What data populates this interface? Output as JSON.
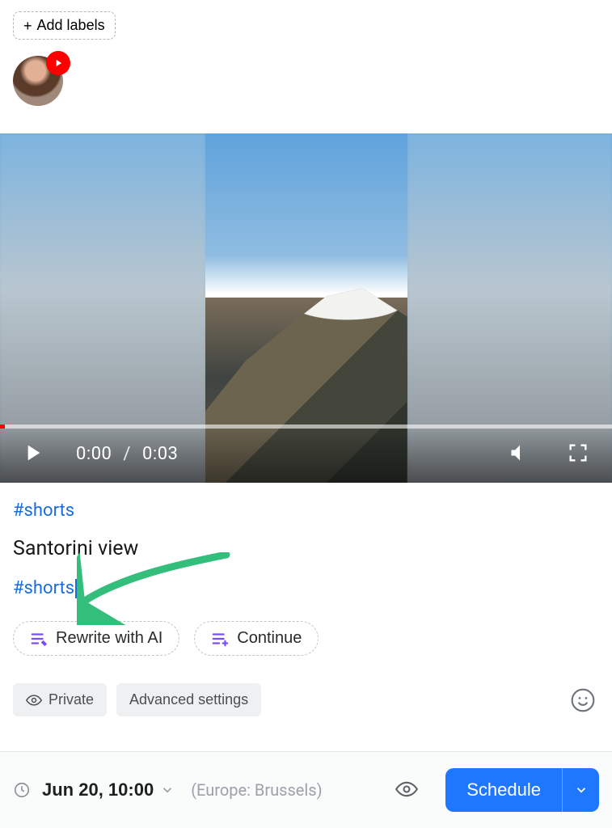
{
  "header": {
    "add_labels": "Add labels"
  },
  "account": {
    "platform_icon": "youtube"
  },
  "video": {
    "current_time": "0:00",
    "separator": "/",
    "duration": "0:03"
  },
  "caption": {
    "hashtag_top": "#shorts",
    "title": "Santorini view",
    "hashtag_bottom": "#shorts"
  },
  "ai": {
    "rewrite": "Rewrite with AI",
    "continue": "Continue"
  },
  "settings": {
    "private": "Private",
    "advanced": "Advanced settings"
  },
  "footer": {
    "datetime": "Jun 20, 10:00",
    "timezone": "(Europe: Brussels)",
    "schedule": "Schedule"
  },
  "colors": {
    "accent": "#1f77ff",
    "link": "#1a6ddb",
    "youtube": "#ff0000",
    "annotation_arrow": "#33bf7b"
  }
}
